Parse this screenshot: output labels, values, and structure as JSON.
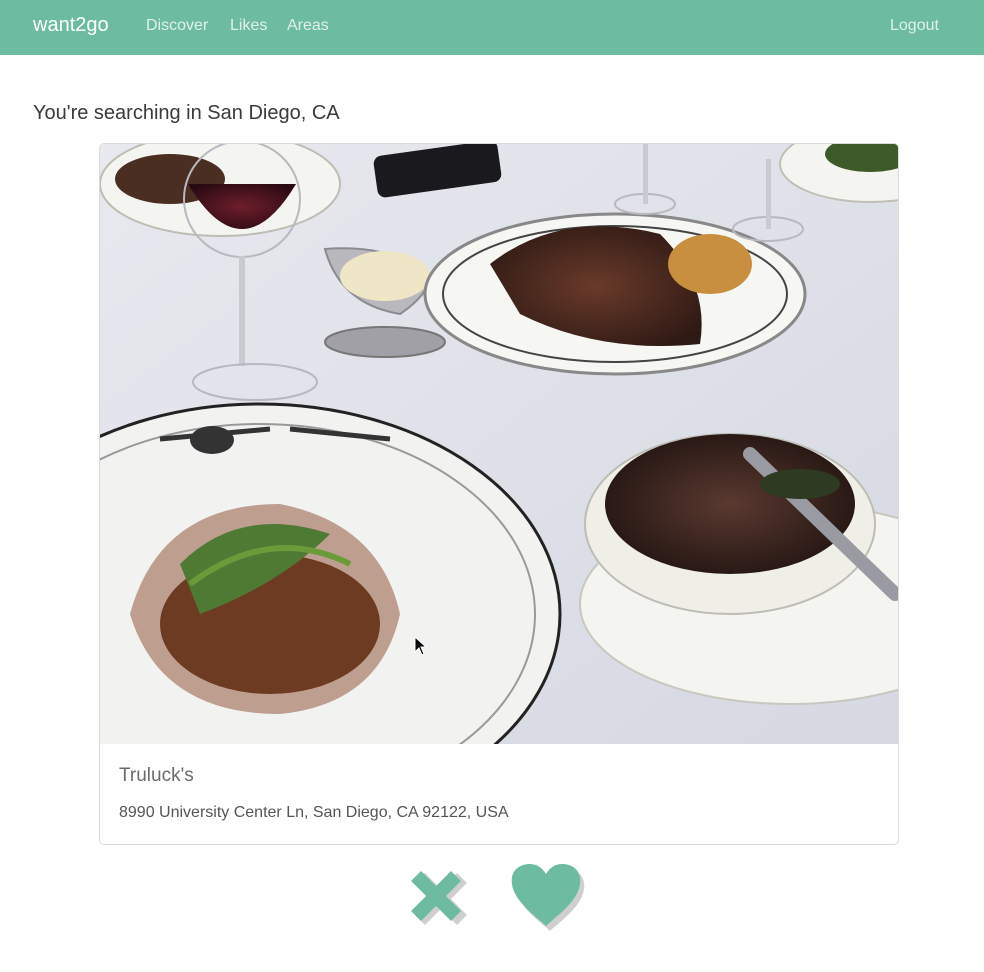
{
  "nav": {
    "brand": "want2go",
    "links": [
      "Discover",
      "Likes",
      "Areas"
    ],
    "logout": "Logout"
  },
  "search": {
    "heading": "You're searching in San Diego, CA"
  },
  "restaurant": {
    "name": "Truluck's",
    "address": "8990 University Center Ln, San Diego, CA 92122, USA"
  },
  "actions": {
    "dislike_icon": "x-icon",
    "like_icon": "heart-icon"
  },
  "colors": {
    "accent": "#6dbca1",
    "accent_shadow": "#cfcfcf"
  }
}
